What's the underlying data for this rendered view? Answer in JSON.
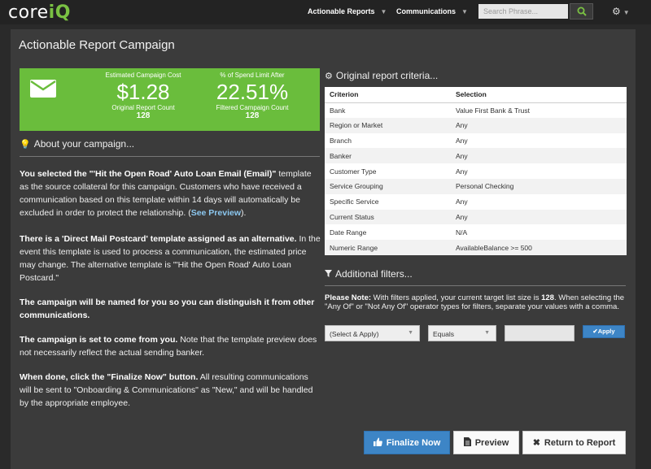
{
  "nav": {
    "logo_text": "core",
    "logo_accent": "iQ",
    "items": [
      {
        "label": "Actionable Reports"
      },
      {
        "label": "Communications"
      }
    ],
    "search_placeholder": "Search Phrase...",
    "search_icon": "search-icon",
    "settings_icon": "gear-icon"
  },
  "page": {
    "title": "Actionable Report Campaign"
  },
  "stats": {
    "cost_label": "Estimated Campaign Cost",
    "cost_value": "$1.28",
    "original_count_label": "Original Report Count",
    "original_count": "128",
    "spend_label": "% of Spend Limit After",
    "spend_value": "22.51%",
    "filtered_count_label": "Filtered Campaign Count",
    "filtered_count": "128"
  },
  "about": {
    "heading": "About your campaign...",
    "p1_b1": "You selected the \"'Hit the Open Road' Auto Loan Email (Email)\"",
    "p1_t1": " template as the source collateral for this campaign. Customers who have received a communication based on this template within 14 days will automatically be excluded in order to protect the relationship. (",
    "p1_link": "See Preview",
    "p1_t2": ").",
    "p2_b": "There is a 'Direct Mail Postcard' template assigned as an alternative.",
    "p2_t": " In the event this template is used to process a communication, the estimated price may change. The alternative template is \"'Hit the Open Road' Auto Loan Postcard.\"",
    "p3_b": "The campaign will be named for you so you can distinguish it from other communications.",
    "p4_b": "The campaign is set to come from you.",
    "p4_t": " Note that the template preview does not necessarily reflect the actual sending banker.",
    "p5_b": "When done, click the \"Finalize Now\" button.",
    "p5_t": " All resulting communications will be sent to \"Onboarding & Communications\" as \"New,\" and will be handled by the appropriate employee."
  },
  "criteria": {
    "heading": "Original report criteria...",
    "columns": [
      "Criterion",
      "Selection"
    ],
    "rows": [
      [
        "Bank",
        "Value First Bank & Trust"
      ],
      [
        "Region or Market",
        "Any"
      ],
      [
        "Branch",
        "Any"
      ],
      [
        "Banker",
        "Any"
      ],
      [
        "Customer Type",
        "Any"
      ],
      [
        "Service Grouping",
        "Personal Checking"
      ],
      [
        "Specific Service",
        "Any"
      ],
      [
        "Current Status",
        "Any"
      ],
      [
        "Date Range",
        "N/A"
      ],
      [
        "Numeric Range",
        "AvailableBalance >= 500"
      ]
    ]
  },
  "filters": {
    "heading": "Additional filters...",
    "note_bold": "Please Note:",
    "note_t1": " With filters applied, your current target list size is ",
    "note_count": "128",
    "note_t2": ". When selecting the \"Any Of\" or \"Not Any Of\" operator types for filters, separate your values with a comma.",
    "field_select": "(Select & Apply)",
    "operator_select": "Equals",
    "value_input": "",
    "apply_label": "Apply"
  },
  "buttons": {
    "finalize": "Finalize Now",
    "preview": "Preview",
    "return": "Return to Report"
  },
  "colors": {
    "accent_green": "#6abd3c",
    "primary_blue": "#3d85c6"
  }
}
